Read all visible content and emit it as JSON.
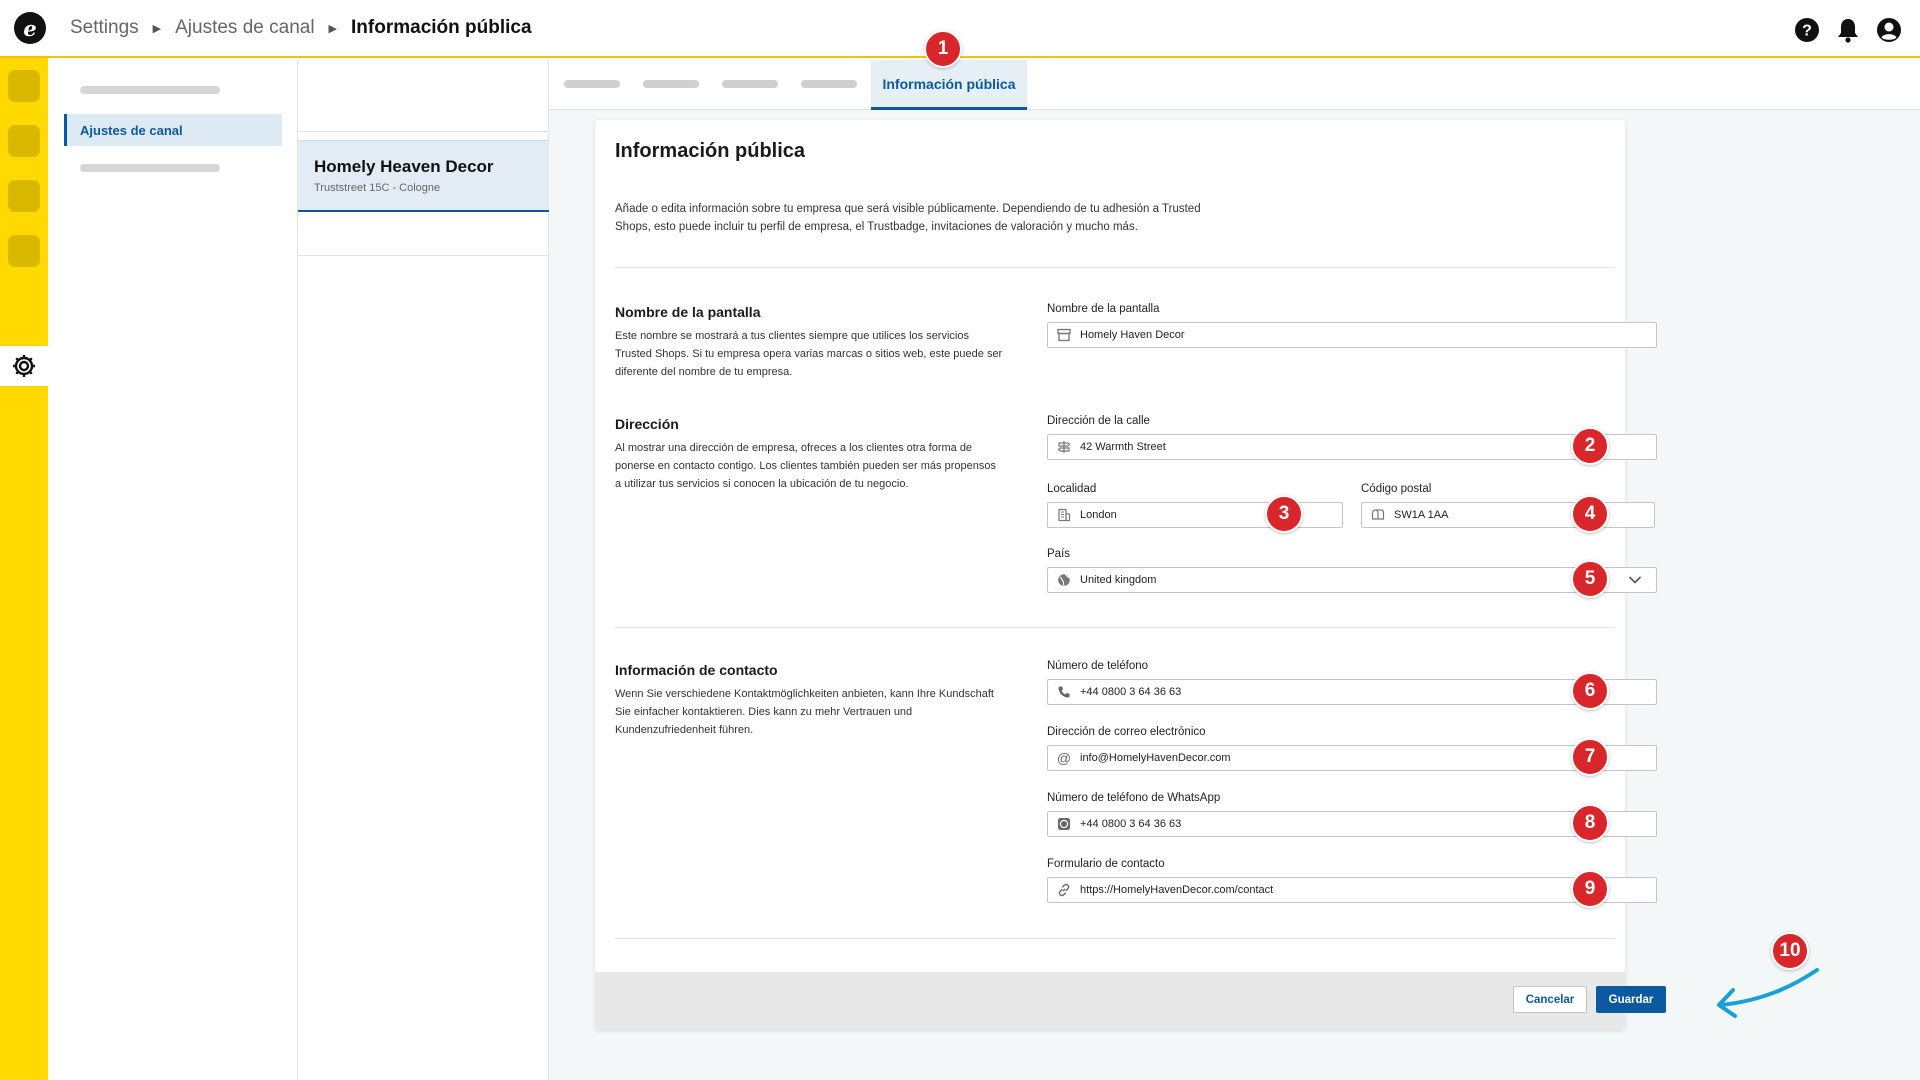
{
  "breadcrumb": [
    "Settings",
    "Ajustes de canal",
    "Información pública"
  ],
  "nav": {
    "active_item": "Ajustes de canal"
  },
  "shop": {
    "name": "Homely Heaven Decor",
    "address": "Truststreet 15C - Cologne"
  },
  "tabs": {
    "active": "Información pública"
  },
  "card": {
    "title": "Información pública",
    "description": "Añade o edita información sobre tu empresa que será visible públicamente. Dependiendo de tu adhesión a Trusted Shops, esto puede incluir tu perfil de empresa, el Trustbadge, invitaciones de valoración y mucho más."
  },
  "display_name": {
    "title": "Nombre de la pantalla",
    "description": "Este nombre se mostrará a tus clientes siempre que utilices los servicios Trusted Shops. Si tu empresa opera varias marcas o sitios web, este puede ser diferente del nombre de tu empresa.",
    "field_label": "Nombre de la pantalla",
    "value": "Homely Haven Decor",
    "icon": "storefront-icon"
  },
  "address": {
    "title": "Dirección",
    "description": "Al mostrar una dirección de empresa, ofreces a los clientes otra forma de ponerse en contacto contigo. Los clientes también pueden ser más propensos a utilizar tus servicios si conocen la ubicación de tu negocio.",
    "street_label": "Dirección de la calle",
    "street_value": "42 Warmth Street",
    "city_label": "Localidad",
    "city_value": "London",
    "zip_label": "Código postal",
    "zip_value": "SW1A 1AA",
    "country_label": "País",
    "country_value": "United kingdom"
  },
  "contact": {
    "title": "Información de contacto",
    "description": " Wenn Sie verschiedene Kontaktmöglichkeiten anbieten, kann Ihre Kundschaft Sie einfacher kontaktieren. Dies kann zu mehr Vertrauen und Kundenzufriedenheit führen.",
    "phone_label": "Número de teléfono",
    "phone_value": "+44 0800 3 64 36 63",
    "email_label": "Dirección de correo electrónico",
    "email_value": "info@HomelyHavenDecor.com",
    "whatsapp_label": "Número de teléfono de WhatsApp",
    "whatsapp_value": "+44 0800 3 64 36 63",
    "form_label": "Formulario de contacto",
    "form_value": "https://HomelyHavenDecor.com/contact"
  },
  "buttons": {
    "cancel": "Cancelar",
    "save": "Guardar"
  },
  "badges": [
    "1",
    "2",
    "3",
    "4",
    "5",
    "6",
    "7",
    "8",
    "9",
    "10"
  ],
  "colors": {
    "accent": "#0b5aa0",
    "rail": "#ffd900",
    "badge": "#d8262b",
    "arrow": "#1aa0d8"
  }
}
